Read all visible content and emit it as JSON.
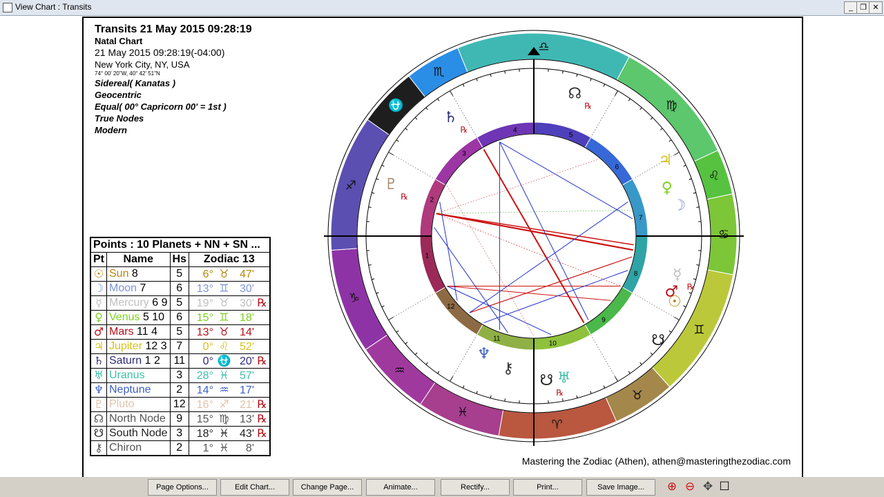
{
  "window": {
    "title": "View Chart : Transits",
    "minimize": "_",
    "restore": "❐",
    "close": "✕"
  },
  "header": {
    "title": "Transits 21 May 2015 09:28:19",
    "chart_kind": "Natal Chart",
    "datetime": "21 May 2015 09:28:19(-04:00)",
    "location": "New York City, NY, USA",
    "coords": "74° 00' 20\"W, 40° 42' 51\"N",
    "zodiac": "Sidereal( Kanatas )",
    "centric": "Geocentric",
    "houses": "Equal( 00° Capricorn 00' = 1st )",
    "nodes": "True Nodes",
    "rulers": "Modern"
  },
  "table": {
    "caption": "Points : 10 Planets + NN + SN ...",
    "col_pt": "Pt",
    "col_name": "Name",
    "col_hs": "Hs",
    "col_zodiac": "Zodiac 13",
    "rows": [
      {
        "glyph": "☉",
        "name": "Sun",
        "rules": "8",
        "hs": "5",
        "deg": "6°",
        "sign": "♉",
        "min": "47'",
        "rx": "",
        "color": "#b8860b"
      },
      {
        "glyph": "☽",
        "name": "Moon",
        "rules": "7",
        "hs": "6",
        "deg": "13°",
        "sign": "♊",
        "min": "30'",
        "rx": "",
        "color": "#7d93d6"
      },
      {
        "glyph": "☿",
        "name": "Mercury",
        "rules": "6 9",
        "hs": "5",
        "deg": "19°",
        "sign": "♉",
        "min": "30'",
        "rx": "℞",
        "color": "#bfbfbf"
      },
      {
        "glyph": "♀",
        "name": "Venus",
        "rules": "5  10",
        "hs": "6",
        "deg": "15°",
        "sign": "♊",
        "min": "18'",
        "rx": "",
        "color": "#7dd11f"
      },
      {
        "glyph": "♂",
        "name": "Mars",
        "rules": "11 4",
        "hs": "5",
        "deg": "13°",
        "sign": "♉",
        "min": "14'",
        "rx": "",
        "color": "#b5121b"
      },
      {
        "glyph": "♃",
        "name": "Jupiter",
        "rules": "12 3",
        "hs": "7",
        "deg": "0°",
        "sign": "♌",
        "min": "52'",
        "rx": "",
        "color": "#d6c21a"
      },
      {
        "glyph": "♄",
        "name": "Saturn",
        "rules": "1  2",
        "hs": "11",
        "deg": "0°",
        "sign": "⛎",
        "min": "20'",
        "rx": "℞",
        "color": "#2b2b7a"
      },
      {
        "glyph": "♅",
        "name": "Uranus",
        "rules": "",
        "hs": "3",
        "deg": "28°",
        "sign": "♓",
        "min": "57'",
        "rx": "",
        "color": "#3fbfa8"
      },
      {
        "glyph": "♆",
        "name": "Neptune",
        "rules": "",
        "hs": "2",
        "deg": "14°",
        "sign": "♒",
        "min": "17'",
        "rx": "",
        "color": "#3b5fc4"
      },
      {
        "glyph": "♇",
        "name": "Pluto",
        "rules": "",
        "hs": "12",
        "deg": "16°",
        "sign": "♐",
        "min": "21'",
        "rx": "℞",
        "color": "#e0c2a8"
      },
      {
        "glyph": "☊",
        "name": "North Node",
        "rules": "",
        "hs": "9",
        "deg": "15°",
        "sign": "♍",
        "min": "13'",
        "rx": "℞",
        "color": "#555555"
      },
      {
        "glyph": "☋",
        "name": "South Node",
        "rules": "",
        "hs": "3",
        "deg": "18°",
        "sign": "♓",
        "min": "43'",
        "rx": "℞",
        "color": "#222222"
      },
      {
        "glyph": "⚷",
        "name": "Chiron",
        "rules": "",
        "hs": "2",
        "deg": "1°",
        "sign": "♓",
        "min": "8'",
        "rx": "",
        "color": "#555555"
      }
    ]
  },
  "wheel": {
    "signs": [
      {
        "glyph": "♍",
        "color": "#5cc76d"
      },
      {
        "glyph": "♌",
        "color": "#56c23f"
      },
      {
        "glyph": "♋",
        "color": "#7cc638"
      },
      {
        "glyph": "♊",
        "color": "#bbc83a"
      },
      {
        "glyph": "♉",
        "color": "#a4874a"
      },
      {
        "glyph": "♈",
        "color": "#b9573f"
      },
      {
        "glyph": "♓",
        "color": "#a73e8e"
      },
      {
        "glyph": "♒",
        "color": "#a0399e"
      },
      {
        "glyph": "♑",
        "color": "#8e33a6"
      },
      {
        "glyph": "♐",
        "color": "#5b4fb2"
      },
      {
        "glyph": "⛎",
        "color": "#1e1e1e"
      },
      {
        "glyph": "♏",
        "color": "#2b8ee6"
      },
      {
        "glyph": "♎",
        "color": "#3fb8b4"
      }
    ],
    "houses": [
      "1",
      "2",
      "3",
      "4",
      "5",
      "6",
      "7",
      "8",
      "9",
      "10",
      "11",
      "12"
    ],
    "transit_glyphs": [
      {
        "glyph": "☊",
        "rx": "℞",
        "color": "#333"
      },
      {
        "glyph": "♄",
        "rx": "℞",
        "color": "#2b2b7a"
      },
      {
        "glyph": "♇",
        "rx": "℞",
        "color": "#a58868"
      },
      {
        "glyph": "♃",
        "rx": "",
        "color": "#d6c21a"
      },
      {
        "glyph": "♀",
        "rx": "",
        "color": "#7dd11f"
      },
      {
        "glyph": "☽",
        "rx": "",
        "color": "#7d93d6"
      },
      {
        "glyph": "☿",
        "rx": "℞",
        "color": "#bfbfbf"
      },
      {
        "glyph": "♂",
        "rx": "",
        "color": "#b5121b"
      },
      {
        "glyph": "☉",
        "rx": "",
        "color": "#b8860b"
      },
      {
        "glyph": "☋",
        "rx": "",
        "color": "#222"
      },
      {
        "glyph": "♆",
        "rx": "",
        "color": "#3b5fc4"
      },
      {
        "glyph": "⚷",
        "rx": "",
        "color": "#333"
      },
      {
        "glyph": "☋",
        "rx": "℞",
        "color": "#222"
      },
      {
        "glyph": "♅",
        "rx": "",
        "color": "#3fbfa8"
      }
    ]
  },
  "footer": {
    "credit": "Mastering the Zodiac (Athen), athen@masteringthezodiac.com"
  },
  "toolbar": {
    "buttons": [
      "Page Options...",
      "Edit Chart...",
      "Change Page...",
      "Animate...",
      "Rectify...",
      "Print...",
      "Save Image..."
    ],
    "zoom_in": "⊕",
    "zoom_out": "⊖",
    "pan": "✥",
    "fit": "☐"
  },
  "colors": {
    "aspect_hard": "#cc1111",
    "aspect_soft": "#2233cc",
    "frame": "#000000"
  }
}
